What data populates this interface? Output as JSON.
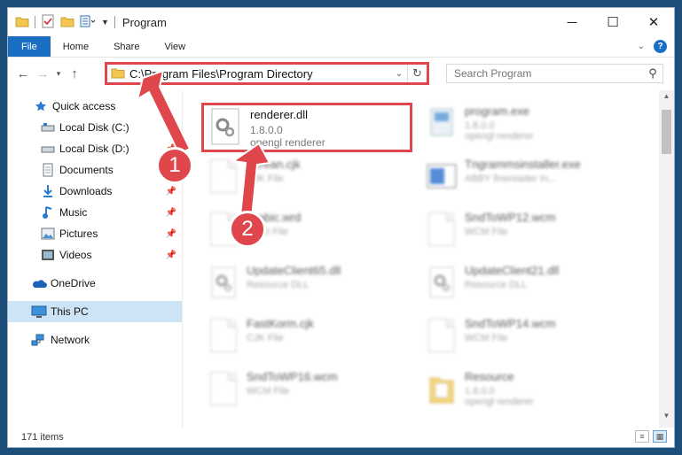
{
  "window": {
    "title": "Program",
    "controls": {
      "minimize": "─",
      "maximize": "☐",
      "close": "✕"
    }
  },
  "ribbon": {
    "tabs": [
      "File",
      "Home",
      "Share",
      "View"
    ],
    "help": "?"
  },
  "address": {
    "path": "C:\\Program Files\\Program Directory",
    "search_placeholder": "Search Program"
  },
  "sidebar": {
    "items": [
      {
        "label": "Quick access",
        "icon": "star-icon"
      },
      {
        "label": "Local Disk (C:)",
        "icon": "drive-icon"
      },
      {
        "label": "Local Disk (D:)",
        "icon": "drive-icon"
      },
      {
        "label": "Documents",
        "icon": "documents-icon"
      },
      {
        "label": "Downloads",
        "icon": "download-icon"
      },
      {
        "label": "Music",
        "icon": "music-icon"
      },
      {
        "label": "Pictures",
        "icon": "pictures-icon"
      },
      {
        "label": "Videos",
        "icon": "videos-icon"
      },
      {
        "label": "OneDrive",
        "icon": "cloud-icon"
      },
      {
        "label": "This PC",
        "icon": "computer-icon"
      },
      {
        "label": "Network",
        "icon": "network-icon"
      }
    ]
  },
  "files": [
    {
      "name": "renderer.dll",
      "line2": "1.8.0.0",
      "line3": "opengl renderer",
      "highlighted": true
    },
    {
      "name": "program.exe",
      "line2": "1.8.0.0",
      "line3": "opengl renderer"
    },
    {
      "name": "Screan.cjk",
      "line2": "CJK File"
    },
    {
      "name": "Tngrammsinstaller.exe",
      "line2": "ABBY finereader In..."
    },
    {
      "name": "Arabic.wrd",
      "line2": "WRD File"
    },
    {
      "name": "SndToWP12.wcm",
      "line2": "WCM File"
    },
    {
      "name": "UpdateClient65.dll",
      "line2": "Resource DLL"
    },
    {
      "name": "UpdateClient21.dll",
      "line2": "Resource DLL"
    },
    {
      "name": "FastKorm.cjk",
      "line2": "CJK File"
    },
    {
      "name": "SndToWP14.wcm",
      "line2": "WCM File"
    },
    {
      "name": "SndToWP16.wcm",
      "line2": "WCM File"
    },
    {
      "name": "Resource",
      "line2": "1.8.0.0",
      "line3": "opengl renderer"
    }
  ],
  "status": {
    "count": "171 items"
  },
  "annotations": {
    "step1": "1",
    "step2": "2"
  },
  "colors": {
    "accent": "#1a6fc4",
    "highlight": "#e0474c",
    "selected": "#cde4f7"
  }
}
